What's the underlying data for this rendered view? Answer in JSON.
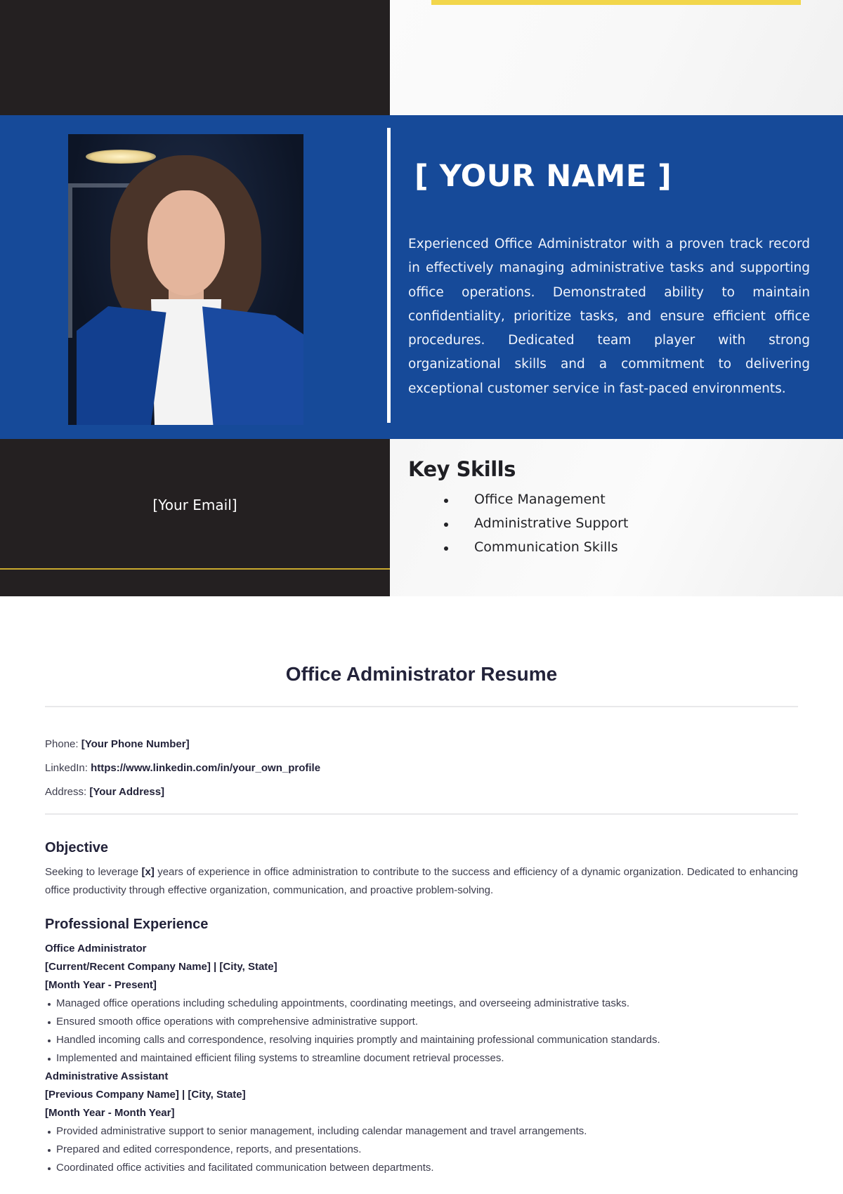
{
  "preview": {
    "name": "[ YOUR NAME ]",
    "summary": "Experienced Office Administrator with a proven track record in effectively managing administrative tasks and supporting office operations. Demonstrated ability to maintain confidentiality, prioritize tasks, and ensure efficient office procedures. Dedicated team player with strong organizational skills and a commitment to delivering exceptional customer service in fast-paced environments.",
    "email": "[Your Email]",
    "photo_alt": "Portrait of a woman in a blue blazer",
    "skills_title": "Key Skills",
    "skills": [
      "Office Management",
      "Administrative Support",
      "Communication Skills"
    ],
    "colors": {
      "dark": "#242021",
      "blue": "#164a99",
      "yellow": "#f2d64b",
      "gold": "#c9a92e"
    }
  },
  "resume": {
    "title": "Office Administrator Resume",
    "contact": [
      {
        "label": "Phone:",
        "value": "[Your Phone Number]"
      },
      {
        "label": "LinkedIn:",
        "value": "https://www.linkedin.com/in/your_own_profile"
      },
      {
        "label": "Address:",
        "value": "[Your Address]"
      }
    ],
    "objective": {
      "heading": "Objective",
      "before": "Seeking to leverage ",
      "highlight": "[x]",
      "after": " years of experience in office administration to contribute to the success and efficiency of a dynamic organization. Dedicated to enhancing office productivity through effective organization, communication, and proactive problem-solving."
    },
    "experience": {
      "heading": "Professional Experience",
      "jobs": [
        {
          "title": "Office Administrator",
          "company": "[Current/Recent Company Name] | [City, State]",
          "dates": "[Month Year - Present]",
          "bullets": [
            "Managed office operations including scheduling appointments, coordinating meetings, and overseeing administrative tasks.",
            "Ensured smooth office operations with comprehensive administrative support.",
            "Handled incoming calls and correspondence, resolving inquiries promptly and maintaining professional communication standards.",
            "Implemented and maintained efficient filing systems to streamline document retrieval processes."
          ]
        },
        {
          "title": "Administrative Assistant",
          "company": "[Previous Company Name] | [City, State]",
          "dates": "[Month Year - Month Year]",
          "bullets": [
            "Provided administrative support to senior management, including calendar management and travel arrangements.",
            "Prepared and edited correspondence, reports, and presentations.",
            "Coordinated office activities and facilitated communication between departments."
          ]
        }
      ]
    }
  }
}
